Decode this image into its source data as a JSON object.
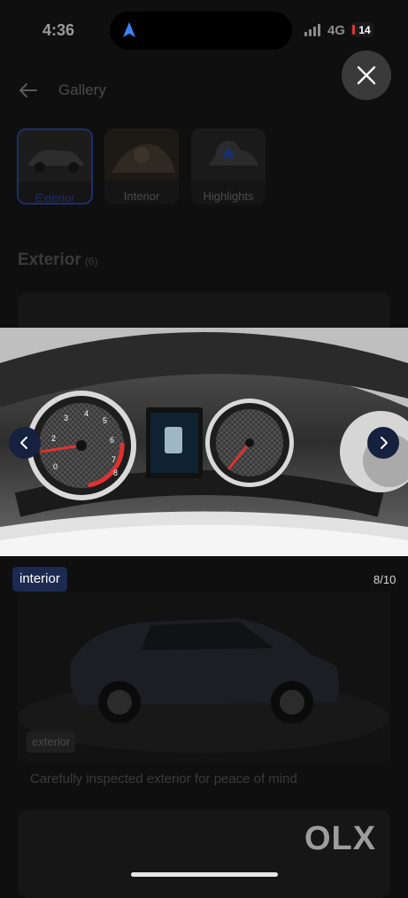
{
  "status_bar": {
    "time": "4:36",
    "network": "4G",
    "battery": "14"
  },
  "header": {
    "title": "Gallery"
  },
  "tabs": [
    {
      "label": "Exterior",
      "active": true
    },
    {
      "label": "Interior",
      "active": false
    },
    {
      "label": "Highlights",
      "active": false
    }
  ],
  "section": {
    "title": "Exterior",
    "count": "(6)"
  },
  "viewer": {
    "badge": "interior",
    "counter": "8/10"
  },
  "next_card": {
    "badge": "exterior",
    "caption": "Carefully inspected exterior for peace of mind"
  },
  "brand": {
    "logo": "OLX"
  },
  "icons": {
    "back": "back-arrow-icon",
    "close": "close-icon",
    "prev": "chevron-left-icon",
    "next": "chevron-right-icon"
  },
  "colors": {
    "accent": "#1c2f6a",
    "overlay": "#0f0f10",
    "badge": "#1c2a4f"
  }
}
